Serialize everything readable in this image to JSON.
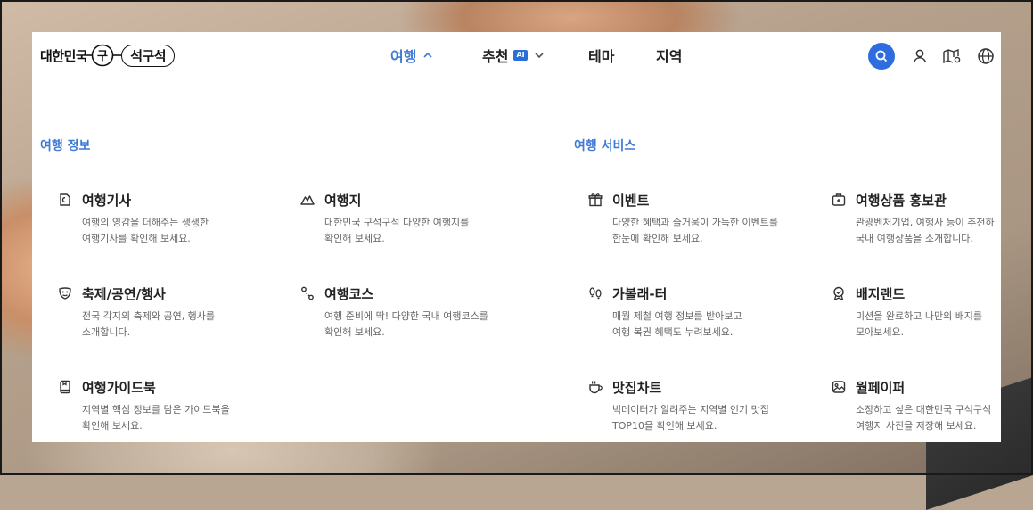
{
  "brand": {
    "logo_text": "대한민국 구석구석",
    "logo_left": "대한민국",
    "logo_mid": "구",
    "logo_right": "석구석"
  },
  "nav": {
    "items": [
      {
        "label": "여행",
        "active": true,
        "chevron": "chevron-up-icon"
      },
      {
        "label": "추천",
        "active": false,
        "badge": "AI",
        "chevron": "chevron-down-icon"
      },
      {
        "label": "테마",
        "active": false
      },
      {
        "label": "지역",
        "active": false
      }
    ]
  },
  "header_icons": [
    "search-icon",
    "user-icon",
    "map-icon",
    "globe-icon"
  ],
  "sections": [
    {
      "title": "여행 정보",
      "items": [
        {
          "title": "여행기사",
          "desc": "여행의 영감을 더해주는 생생한\n여행기사를 확인해 보세요.",
          "icon": "article-icon"
        },
        {
          "title": "여행지",
          "desc": "대한민국 구석구석 다양한 여행지를\n확인해 보세요.",
          "icon": "mountain-icon"
        },
        {
          "title": "축제/공연/행사",
          "desc": "전국 각지의 축제와 공연, 행사를\n소개합니다.",
          "icon": "mask-icon"
        },
        {
          "title": "여행코스",
          "desc": "여행 준비에 딱! 다양한 국내 여행코스를\n확인해 보세요.",
          "icon": "route-icon"
        },
        {
          "title": "여행가이드북",
          "desc": "지역별 핵심 정보를 담은 가이드북을\n확인해 보세요.",
          "icon": "guidebook-icon"
        }
      ]
    },
    {
      "title": "여행 서비스",
      "items": [
        {
          "title": "이벤트",
          "desc": "다양한 혜택과 즐거움이 가득한 이벤트를\n한눈에 확인해 보세요.",
          "icon": "gift-icon"
        },
        {
          "title": "여행상품 홍보관",
          "desc": "관광벤처기업, 여행사 등이 추천하\n국내 여행상품을 소개합니다.",
          "icon": "suitcase-icon"
        },
        {
          "title": "가볼래-터",
          "desc": "매월 제철 여행 정보를 받아보고\n여행 복권 혜택도 누려보세요.",
          "icon": "footprints-icon"
        },
        {
          "title": "배지랜드",
          "desc": "미션을 완료하고 나만의 배지를\n모아보세요.",
          "icon": "badge-icon"
        },
        {
          "title": "맛집차트",
          "desc": "빅데이터가 알려주는 지역별 인기 맛집\nTOP10을 확인해 보세요.",
          "icon": "cup-icon"
        },
        {
          "title": "월페이퍼",
          "desc": "소장하고 싶은 대한민국 구석구석\n여행지 사진을 저장해 보세요.",
          "icon": "image-icon"
        }
      ]
    }
  ],
  "colors": {
    "accent": "#3f7ad6",
    "search_bg": "#2d6de0",
    "title": "#222222",
    "desc": "#666666"
  }
}
